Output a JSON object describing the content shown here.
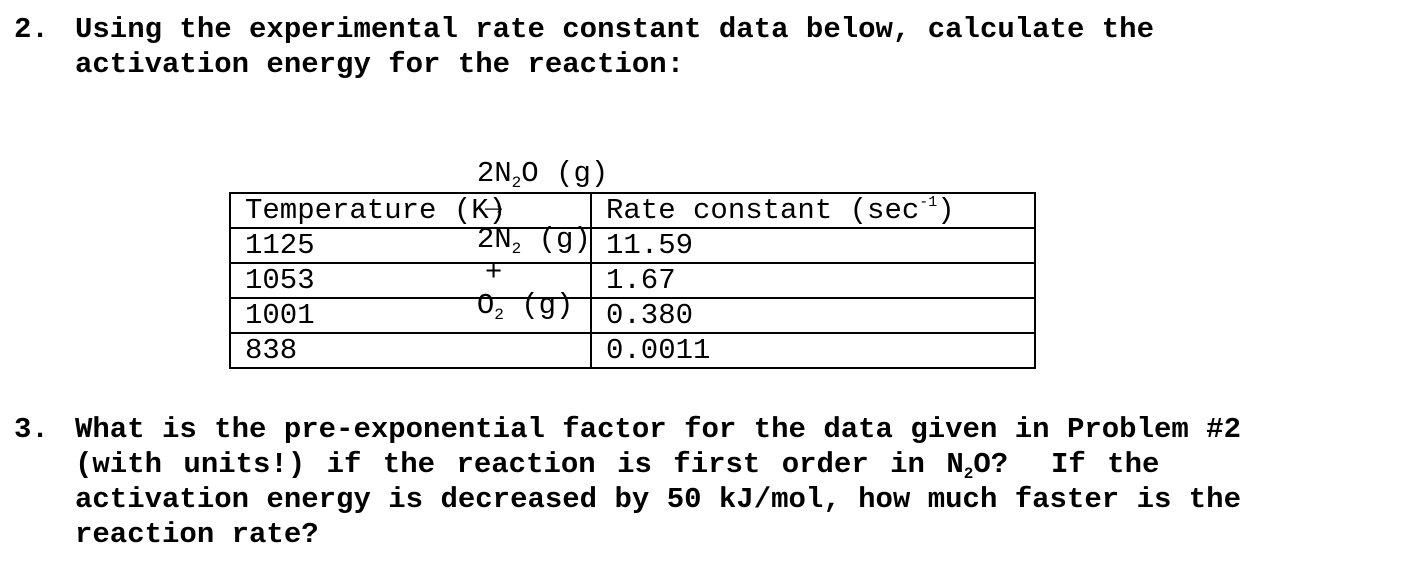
{
  "problem2": {
    "number": "2.",
    "line1": "Using the experimental rate constant data below, calculate the",
    "line2": "activation energy for the reaction:",
    "equation": {
      "reactant_coef": "2N",
      "reactant_sub": "2",
      "reactant_rest": "O (g)",
      "arrow": "→",
      "product1_coef": "2N",
      "product1_sub": "2",
      "product1_rest": " (g)",
      "plus": "+",
      "product2": "O",
      "product2_sub": "2",
      "product2_rest": " (g)"
    },
    "table": {
      "header_temp": "Temperature (K)",
      "header_rate": "Rate constant (sec",
      "header_rate_sup": "-1",
      "header_rate_close": ")",
      "rows": [
        {
          "temp": "1125",
          "rate": "11.59"
        },
        {
          "temp": "1053",
          "rate": "1.67"
        },
        {
          "temp": "1001",
          "rate": "0.380"
        },
        {
          "temp": "838",
          "rate": "0.0011"
        }
      ]
    }
  },
  "problem3": {
    "number": "3.",
    "line1": "What is the pre-exponential factor for the data given in Problem #2",
    "line2_a": "(with units!) if the reaction is first order in N",
    "line2_sub": "2",
    "line2_b": "O?  If the",
    "line3": "activation energy is decreased by 50 kJ/mol, how much faster is the",
    "line4": "reaction rate?"
  }
}
